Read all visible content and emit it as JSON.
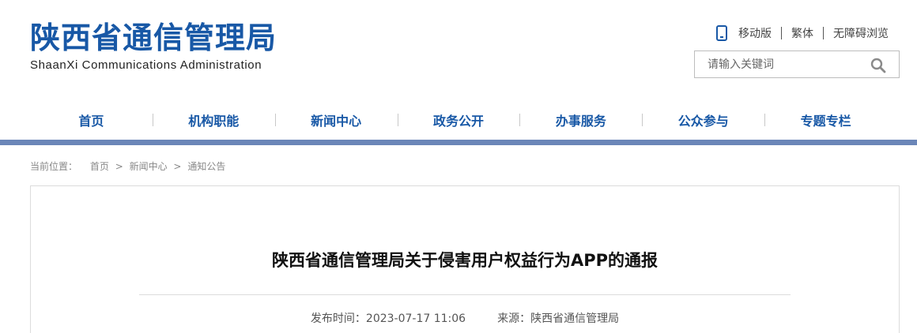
{
  "site": {
    "title": "陕西省通信管理局",
    "subtitle": "ShaanXi Communications Administration"
  },
  "top_links": {
    "mobile": "移动版",
    "traditional": "繁体",
    "accessible": "无障碍浏览",
    "icon": "mobile-phone-icon"
  },
  "search": {
    "placeholder": "请输入关键词",
    "value": "",
    "icon": "search-icon"
  },
  "nav": {
    "items": [
      {
        "label": "首页"
      },
      {
        "label": "机构职能"
      },
      {
        "label": "新闻中心"
      },
      {
        "label": "政务公开"
      },
      {
        "label": "办事服务"
      },
      {
        "label": "公众参与"
      },
      {
        "label": "专题专栏"
      }
    ]
  },
  "breadcrumb": {
    "label": "当前位置：",
    "items": [
      "首页",
      "新闻中心",
      "通知公告"
    ],
    "separator": ">"
  },
  "article": {
    "title": "陕西省通信管理局关于侵害用户权益行为APP的通报",
    "publish_label": "发布时间：",
    "publish_time": "2023-07-17 11:06",
    "source_label": "来源：",
    "source": "陕西省通信管理局"
  },
  "colors": {
    "brand_blue": "#1858a6",
    "nav_bar": "#6b86b8"
  }
}
